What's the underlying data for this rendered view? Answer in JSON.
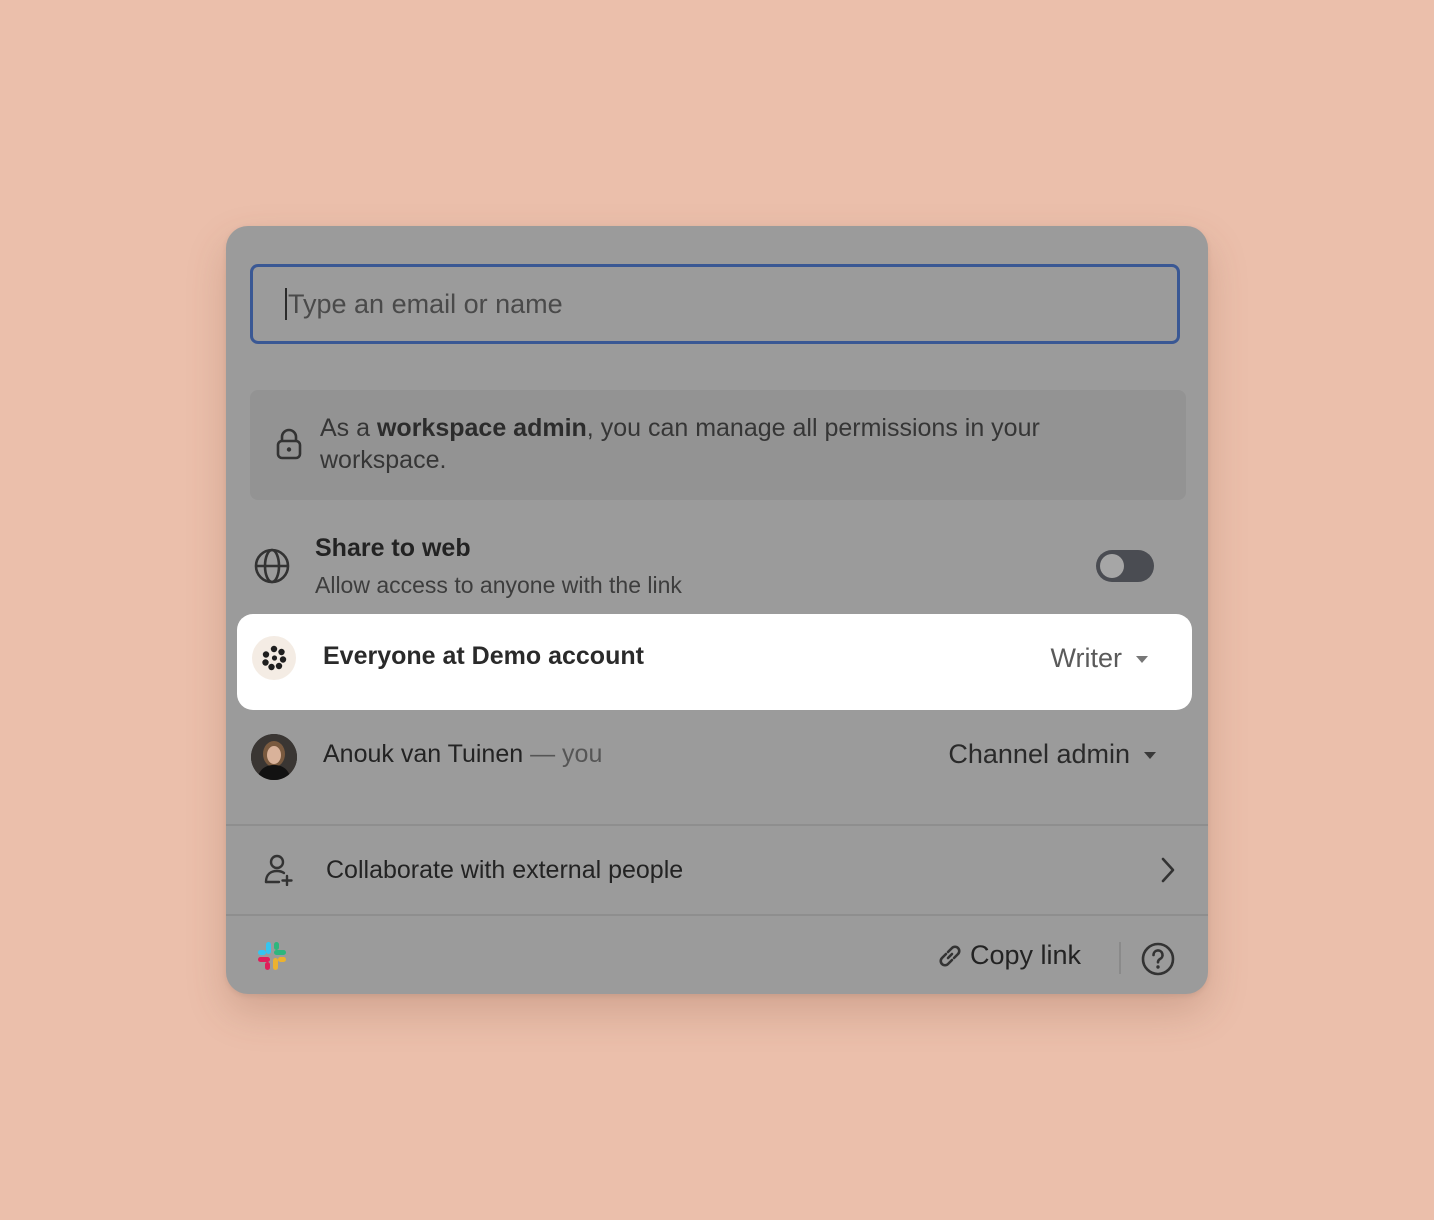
{
  "invite": {
    "placeholder": "Type an email or name"
  },
  "admin_note": {
    "prefix": "As a ",
    "bold": "workspace admin",
    "suffix": ", you can manage all permissions in your workspace."
  },
  "share_web": {
    "title": "Share to web",
    "subtitle": "Allow access to anyone with the link",
    "enabled": false
  },
  "members": [
    {
      "name": "Everyone at Demo account",
      "role": "Writer"
    },
    {
      "name": "Anouk van Tuinen",
      "you_suffix": "— you",
      "role": "Channel admin"
    }
  ],
  "collaborate": {
    "label": "Collaborate with external people"
  },
  "footer": {
    "copy_link": "Copy link"
  },
  "icons": [
    "lock-icon",
    "globe-icon",
    "org-logo-icon",
    "user-avatar",
    "add-person-icon",
    "chevron-right-icon",
    "slack-icon",
    "link-icon",
    "help-icon"
  ],
  "colors": {
    "page_background": "#ebbfab",
    "panel": "#9b9b9b",
    "focus_border": "#3a5894",
    "highlight_row": "#ffffff"
  }
}
